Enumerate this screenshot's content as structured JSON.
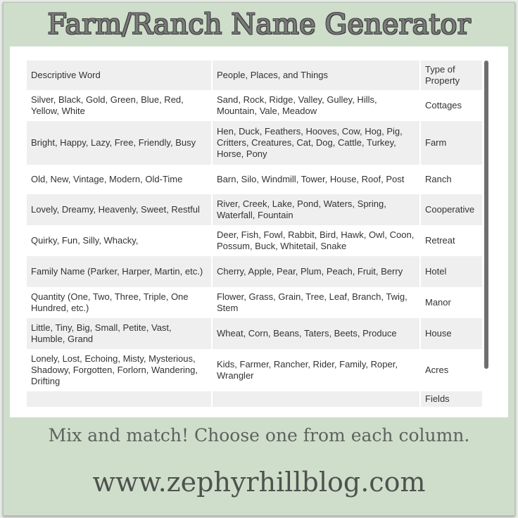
{
  "title": "Farm/Ranch Name Generator",
  "table": {
    "headers": [
      "Descriptive Word",
      "People, Places, and Things",
      "Type of Property"
    ],
    "rows": [
      [
        "Silver, Black, Gold, Green, Blue, Red, Yellow, White",
        "Sand, Rock, Ridge, Valley, Gulley, Hills, Mountain, Vale, Meadow",
        "Cottages"
      ],
      [
        "Bright, Happy, Lazy, Free, Friendly, Busy",
        "Hen, Duck, Feathers, Hooves, Cow, Hog, Pig, Critters, Creatures, Cat, Dog, Cattle, Turkey, Horse, Pony",
        "Farm"
      ],
      [
        "Old, New, Vintage, Modern, Old-Time",
        "Barn, Silo, Windmill, Tower, House, Roof, Post",
        "Ranch"
      ],
      [
        "Lovely, Dreamy, Heavenly, Sweet, Restful",
        "River, Creek, Lake, Pond, Waters, Spring, Waterfall, Fountain",
        "Cooperative"
      ],
      [
        "Quirky, Fun, Silly, Whacky,",
        "Deer, Fish, Fowl, Rabbit, Bird, Hawk, Owl, Coon, Possum, Buck, Whitetail, Snake",
        "Retreat"
      ],
      [
        "Family Name (Parker, Harper, Martin, etc.)",
        "Cherry, Apple, Pear, Plum, Peach, Fruit, Berry",
        "Hotel"
      ],
      [
        "Quantity (One, Two, Three, Triple, One Hundred, etc.)",
        "Flower, Grass, Grain, Tree, Leaf, Branch, Twig, Stem",
        "Manor"
      ],
      [
        "Little, Tiny, Big, Small, Petite, Vast, Humble, Grand",
        "Wheat, Corn, Beans, Taters, Beets, Produce",
        "House"
      ],
      [
        "Lonely, Lost, Echoing, Misty, Mysterious, Shadowy, Forgotten, Forlorn, Wandering, Drifting",
        "Kids, Farmer, Rancher, Rider, Family, Roper, Wrangler",
        "Acres"
      ],
      [
        "",
        "",
        "Fields"
      ]
    ]
  },
  "tagline": "Mix and match! Choose one from each column.",
  "website": "www.zephyrhillblog.com",
  "colors": {
    "background": "#cfdecb",
    "row_alt": "#efefef"
  }
}
